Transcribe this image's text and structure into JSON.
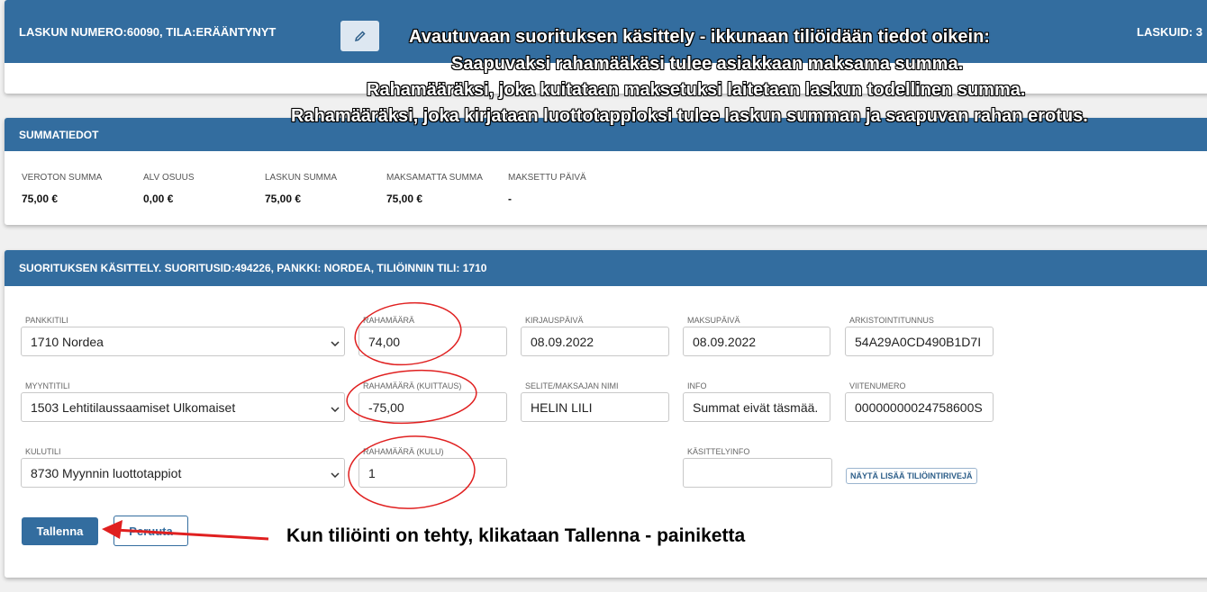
{
  "invoice_header": {
    "label": "LASKUN NUMERO: ",
    "number": "60090",
    "status_label": ", TILA: ",
    "status": "ERÄÄNTYNYT",
    "right_label": "LASKUID: 3"
  },
  "summary": {
    "title": "SUMMATIEDOT",
    "columns": [
      {
        "label": "VEROTON SUMMA",
        "value": "75,00 €"
      },
      {
        "label": "ALV OSUUS",
        "value": "0,00 €"
      },
      {
        "label": "LASKUN SUMMA",
        "value": "75,00 €"
      },
      {
        "label": "MAKSAMATTA SUMMA",
        "value": "75,00 €"
      },
      {
        "label": "MAKSETTU PÄIVÄ",
        "value": "-"
      }
    ]
  },
  "payment": {
    "title_prefix": "SUORITUKSEN KÄSITTELY. SUORITUSID: ",
    "id": "494226",
    "title_bank": ", PANKKI: NORDEA, TILIÖINNIN TILI: 1710",
    "fields": {
      "pankkitili": {
        "label": "PANKKITILI",
        "value": "1710 Nordea"
      },
      "rahamaara": {
        "label": "RAHAMÄÄRÄ",
        "value": "74,00"
      },
      "kirjauspaiva": {
        "label": "KIRJAUSPÄIVÄ",
        "value": "08.09.2022"
      },
      "maksupaiva": {
        "label": "MAKSUPÄIVÄ",
        "value": "08.09.2022"
      },
      "arkistointitunnus": {
        "label": "ARKISTOINTITUNNUS",
        "value": "54A29A0CD490B1D7I"
      },
      "myyntitili": {
        "label": "MYYNTITILI",
        "value": "1503 Lehtitilaussaamiset Ulkomaiset"
      },
      "rahamaara_kuittaus": {
        "label": "RAHAMÄÄRÄ (KUITTAUS)",
        "value": "-75,00"
      },
      "selite": {
        "label": "SELITE/MAKSAJAN NIMI",
        "value": "HELIN LILI"
      },
      "info": {
        "label": "INFO",
        "value": "Summat eivät täsmää."
      },
      "viitenumero": {
        "label": "VIITENUMERO",
        "value": "00000000024758600S"
      },
      "kulutili": {
        "label": "KULUTILI",
        "value": "8730 Myynnin luottotappiot"
      },
      "rahamaara_kulu": {
        "label": "RAHAMÄÄRÄ (KULU)",
        "value": "1"
      },
      "kasittelyinfo": {
        "label": "KÄSITTELYINFO",
        "value": ""
      }
    },
    "more_rows_label": "NÄYTÄ LISÄÄ TILIÖINTIRIVEJÄ",
    "save_label": "Tallenna",
    "cancel_label": "Peruuta"
  },
  "annotations": {
    "line1": "Avautuvaan suorituksen käsittely - ikkunaan tiliöidään tiedot oikein:",
    "line2": "Saapuvaksi rahamääkäsi tulee asiakkaan maksama summa.",
    "line3": "Rahamääräksi, joka kuitataan maksetuksi laitetaan laskun todellinen summa.",
    "line4": "Rahamääräksi, joka kirjataan luottotappioksi tulee laskun summan ja saapuvan rahan erotus.",
    "bottom": "Kun tiliöinti on tehty, klikataan Tallenna - painiketta"
  },
  "icons": {
    "edit": "pencil-icon",
    "dropdown": "chevron-down-icon"
  },
  "colors": {
    "header_blue": "#336d9f",
    "annotation_red": "#e02020"
  }
}
